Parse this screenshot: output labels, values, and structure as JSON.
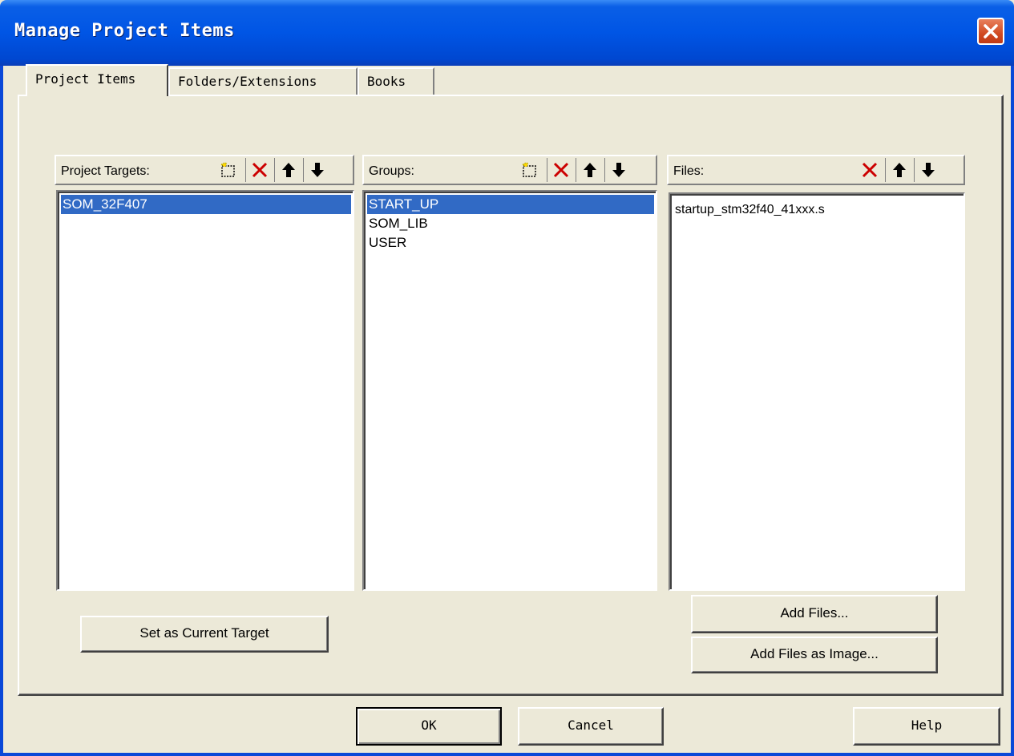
{
  "window": {
    "title": "Manage Project Items"
  },
  "tabs": [
    {
      "label": "Project Items",
      "active": true
    },
    {
      "label": "Folders/Extensions",
      "active": false
    },
    {
      "label": "Books",
      "active": false
    }
  ],
  "targets": {
    "label": "Project Targets:",
    "items": [
      "SOM_32F407"
    ],
    "selected_index": 0
  },
  "groups": {
    "label": "Groups:",
    "items": [
      "START_UP",
      "SOM_LIB",
      "USER"
    ],
    "selected_index": 0
  },
  "files": {
    "label": "Files:",
    "items": [
      "startup_stm32f40_41xxx.s"
    ]
  },
  "buttons": {
    "set_current_target": "Set as Current Target",
    "add_files": "Add Files...",
    "add_files_image": "Add Files as Image...",
    "ok": "OK",
    "cancel": "Cancel",
    "help": "Help"
  },
  "icons": {
    "new": "new-item-icon",
    "delete": "delete-icon",
    "up": "move-up-icon",
    "down": "move-down-icon"
  },
  "colors": {
    "titlebar": "#0055e5",
    "selection": "#316ac5",
    "delete_red": "#cc0000",
    "face": "#ece9d8"
  }
}
